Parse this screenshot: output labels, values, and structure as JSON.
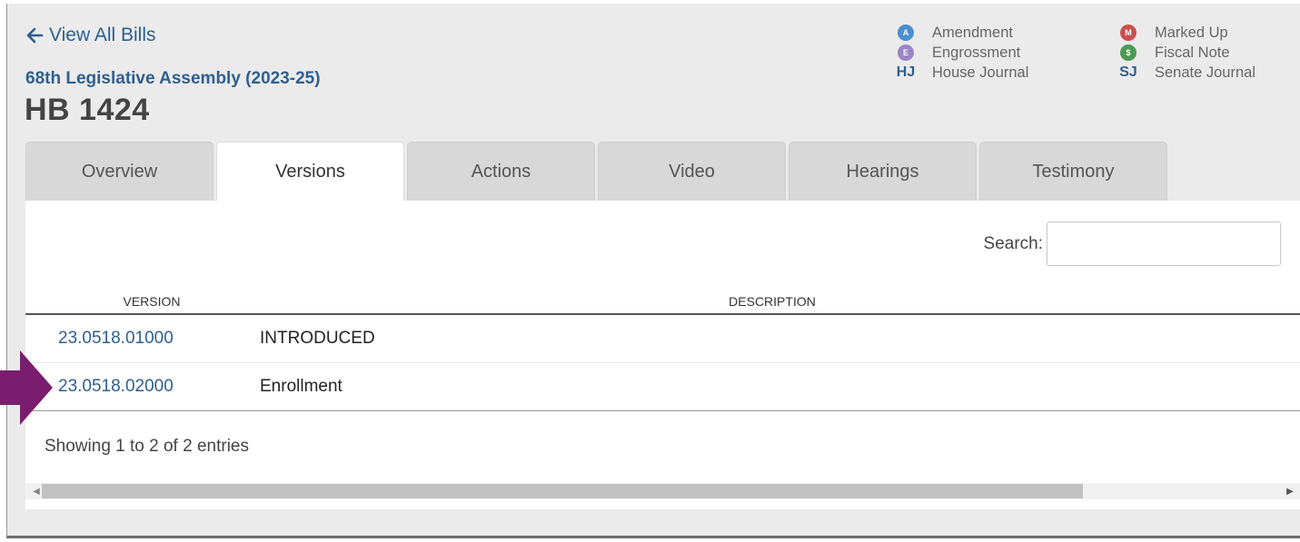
{
  "header": {
    "back_link": "View All Bills",
    "assembly": "68th Legislative Assembly (2023-25)",
    "bill_number": "HB 1424"
  },
  "legend": {
    "left_column": [
      {
        "icon": "amendment-icon",
        "glyph": "A",
        "color": "#4a8fd0",
        "label": "Amendment"
      },
      {
        "icon": "engrossment-icon",
        "glyph": "E",
        "color": "#9b84c7",
        "label": "Engrossment"
      },
      {
        "icon": "house-journal-icon",
        "glyph": "HJ",
        "label": "House Journal"
      }
    ],
    "right_column": [
      {
        "icon": "marked-up-icon",
        "glyph": "M",
        "color": "#c9504f",
        "label": "Marked Up"
      },
      {
        "icon": "fiscal-note-icon",
        "glyph": "$",
        "color": "#4f9a56",
        "label": "Fiscal Note"
      },
      {
        "icon": "senate-journal-icon",
        "glyph": "SJ",
        "label": "Senate Journal"
      }
    ]
  },
  "tabs": [
    {
      "label": "Overview",
      "active": false
    },
    {
      "label": "Versions",
      "active": true
    },
    {
      "label": "Actions",
      "active": false
    },
    {
      "label": "Video",
      "active": false
    },
    {
      "label": "Hearings",
      "active": false
    },
    {
      "label": "Testimony",
      "active": false
    }
  ],
  "search": {
    "label": "Search:",
    "value": ""
  },
  "table": {
    "columns": [
      "VERSION",
      "DESCRIPTION"
    ],
    "rows": [
      {
        "version": "23.0518.01000",
        "description": "INTRODUCED"
      },
      {
        "version": "23.0518.02000",
        "description": "Enrollment"
      }
    ]
  },
  "info": "Showing 1 to 2 of 2 entries",
  "colors": {
    "link": "#2e5f8f",
    "annotation_arrow": "#7a1d6e"
  }
}
